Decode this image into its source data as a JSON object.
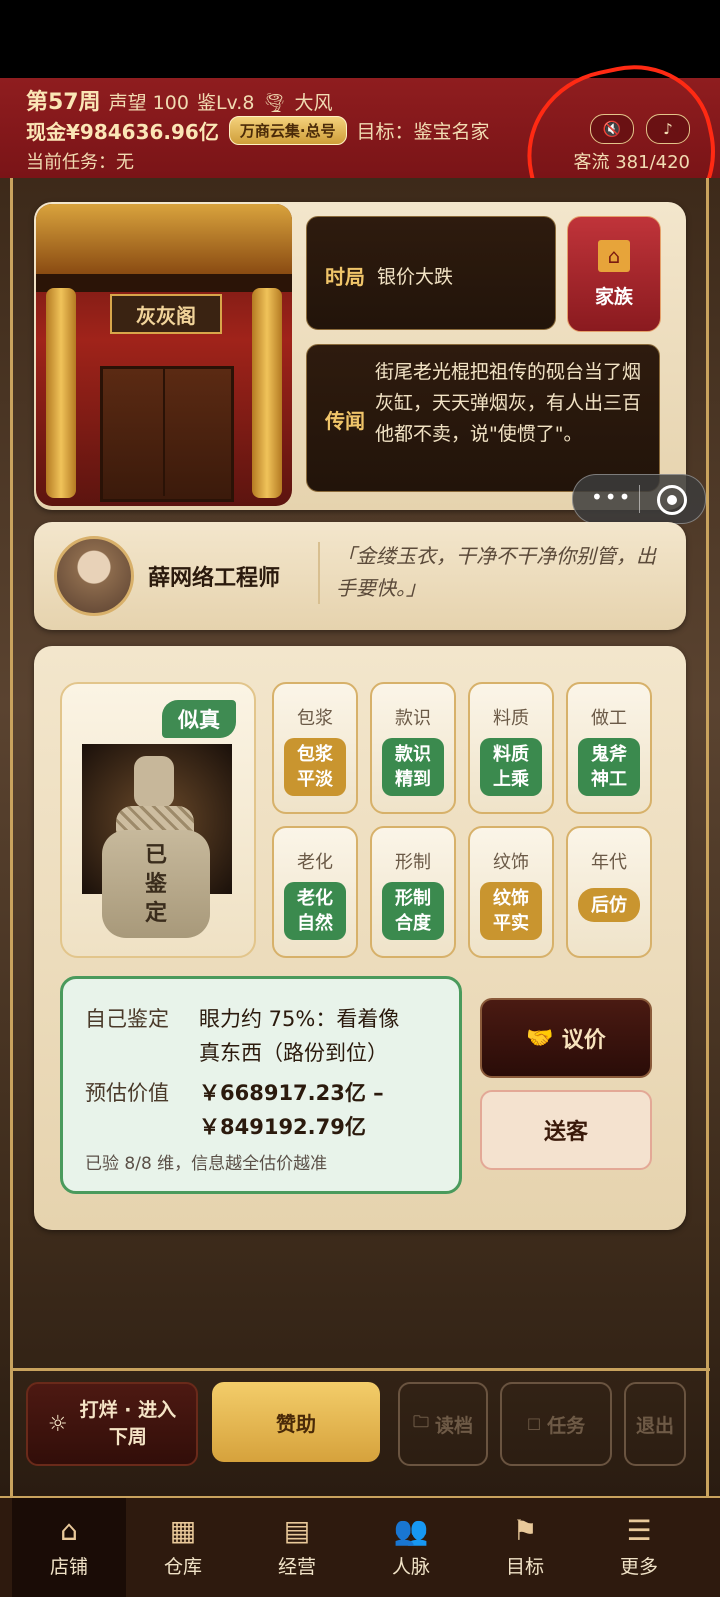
{
  "header": {
    "week": "第57周",
    "reputation": "声望 100",
    "level": "鉴Lv.8",
    "weather": "大风",
    "cash": "现金¥984636.96亿",
    "account_pill": "万商云集·总号",
    "goal": "目标：鉴宝名家",
    "task": "当前任务：无",
    "customer_flow": "客流 381/420",
    "mute_icon": "🔇",
    "music_icon": "♪"
  },
  "shop": {
    "sign": "灰灰阁",
    "situation_label": "时局",
    "situation_value": "银价大跌",
    "family_label": "家族",
    "rumor_label": "传闻",
    "rumor_text": "街尾老光棍把祖传的砚台当了烟灰缸，天天弹烟灰，有人出三百他都不卖，说\"使惯了\"。",
    "miniprogram_more": "•••"
  },
  "customer": {
    "name": "薛网络工程师",
    "quote": "「金缕玉衣，干净不干净你别管，出手要快。」"
  },
  "item": {
    "verdict_badge": "似真",
    "stamp": "已鉴定",
    "stamp_lines": [
      "已",
      "鉴",
      "定"
    ]
  },
  "attributes": [
    {
      "name": "包浆",
      "line1": "包浆",
      "line2": "平淡",
      "color": "gold"
    },
    {
      "name": "款识",
      "line1": "款识",
      "line2": "精到",
      "color": "green"
    },
    {
      "name": "料质",
      "line1": "料质",
      "line2": "上乘",
      "color": "green"
    },
    {
      "name": "做工",
      "line1": "鬼斧",
      "line2": "神工",
      "color": "green"
    },
    {
      "name": "老化",
      "line1": "老化",
      "line2": "自然",
      "color": "green"
    },
    {
      "name": "形制",
      "line1": "形制",
      "line2": "合度",
      "color": "green"
    },
    {
      "name": "纹饰",
      "line1": "纹饰",
      "line2": "平实",
      "color": "gold"
    },
    {
      "name": "年代",
      "line1": "后仿",
      "line2": "",
      "color": "gold"
    }
  ],
  "appraisal": {
    "self_label": "自己鉴定",
    "self_line1": "眼力约 75%：看着像",
    "self_line2": "真东西（路份到位）",
    "estimate_label": "预估价值",
    "estimate_line1": "￥668917.23亿 –",
    "estimate_line2": "￥849192.79亿",
    "checked": "已验 8/8 维，信息越全估价越准"
  },
  "actions": {
    "negotiate": "议价",
    "negotiate_icon": "🤝",
    "dismiss": "送客",
    "next_week_line1": "打烊 · 进入",
    "next_week_line2": "下周",
    "sponsor": "赞助",
    "load": "读档",
    "tasks": "任务",
    "exit": "退出"
  },
  "nav": [
    {
      "label": "店铺",
      "icon": "⌂"
    },
    {
      "label": "仓库",
      "icon": "▦"
    },
    {
      "label": "经营",
      "icon": "▤"
    },
    {
      "label": "人脉",
      "icon": "👥"
    },
    {
      "label": "目标",
      "icon": "⚑"
    },
    {
      "label": "更多",
      "icon": "☰"
    }
  ],
  "colors": {
    "header_red": "#8f1d1f",
    "gold": "#d9b36a",
    "green_badge": "#3b8a4e",
    "gold_badge": "#c9952f",
    "annotation": "#ff2a13"
  }
}
